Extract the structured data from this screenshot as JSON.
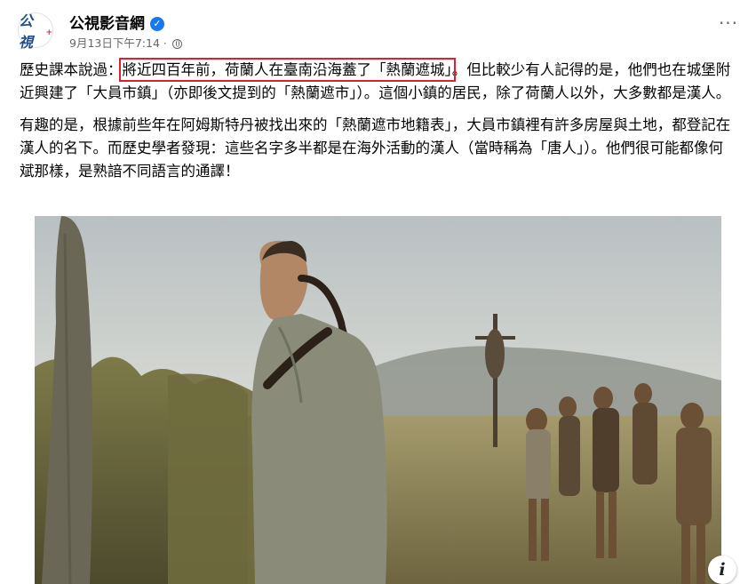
{
  "post": {
    "page_name": "公視影音網",
    "avatar_text": "公視",
    "avatar_plus": "+",
    "timestamp": "9月13日下午7:14",
    "separator": "·",
    "more": "···",
    "verified_mark": "✓"
  },
  "body": {
    "p1_a": "歷史課本說過：",
    "p1_highlight": "將近四百年前，荷蘭人在臺南沿海蓋了「熱蘭遮城」",
    "p1_b": "。但比較少有人記得的是，他們也在城堡附近興建了「大員市鎮」（亦即後文提到的「熱蘭遮市」）。這個小鎮的居民，除了荷蘭人以外，大多數都是漢人。",
    "p2": "有趣的是，根據前些年在阿姆斯特丹被找出來的「熱蘭遮市地籍表」，大員市鎮裡有許多房屋與土地，都登記在漢人的名下。而歷史學者發現：這些名字多半都是在海外活動的漢人（當時稱為「唐人」）。他們很可能都像何斌那樣，是熟諳不同語言的通譯！"
  },
  "photo": {
    "info_label": "i"
  },
  "colors": {
    "highlight_box": "#e0202a",
    "verified": "#1877f2",
    "brand": "#1f4e8c"
  }
}
